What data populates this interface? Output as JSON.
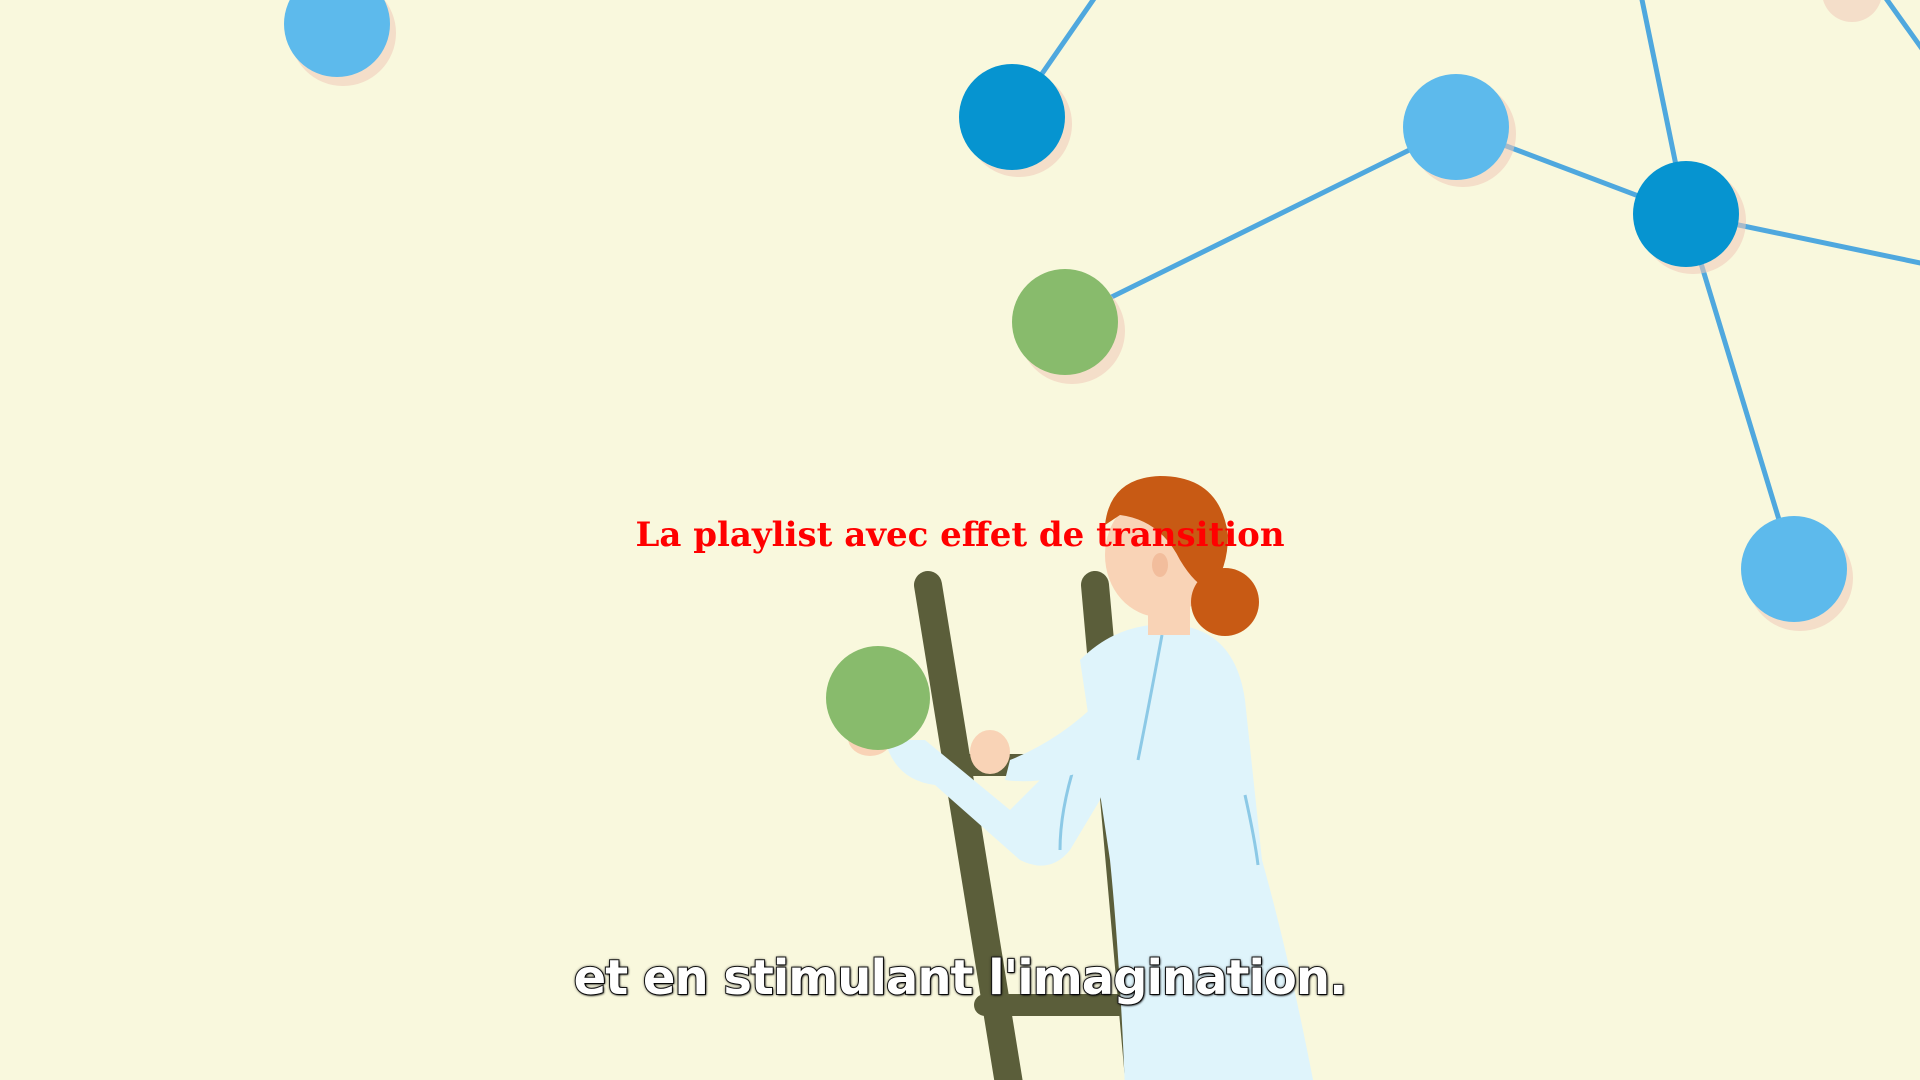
{
  "video": {
    "title_overlay": "La playlist avec effet de transition",
    "subtitle": "et en stimulant l'imagination.",
    "overlay_color": "#ff0000",
    "background_color": "#f9f8dd",
    "palette": {
      "node_light_blue": "#5dbaec",
      "node_dark_blue": "#0694d0",
      "node_green": "#88bb6c",
      "link_blue": "#4fa8de",
      "hair": "#c85a14",
      "skin": "#f9d3b6",
      "coat": "#dff4fb",
      "ladder": "#5b5e3a"
    }
  }
}
